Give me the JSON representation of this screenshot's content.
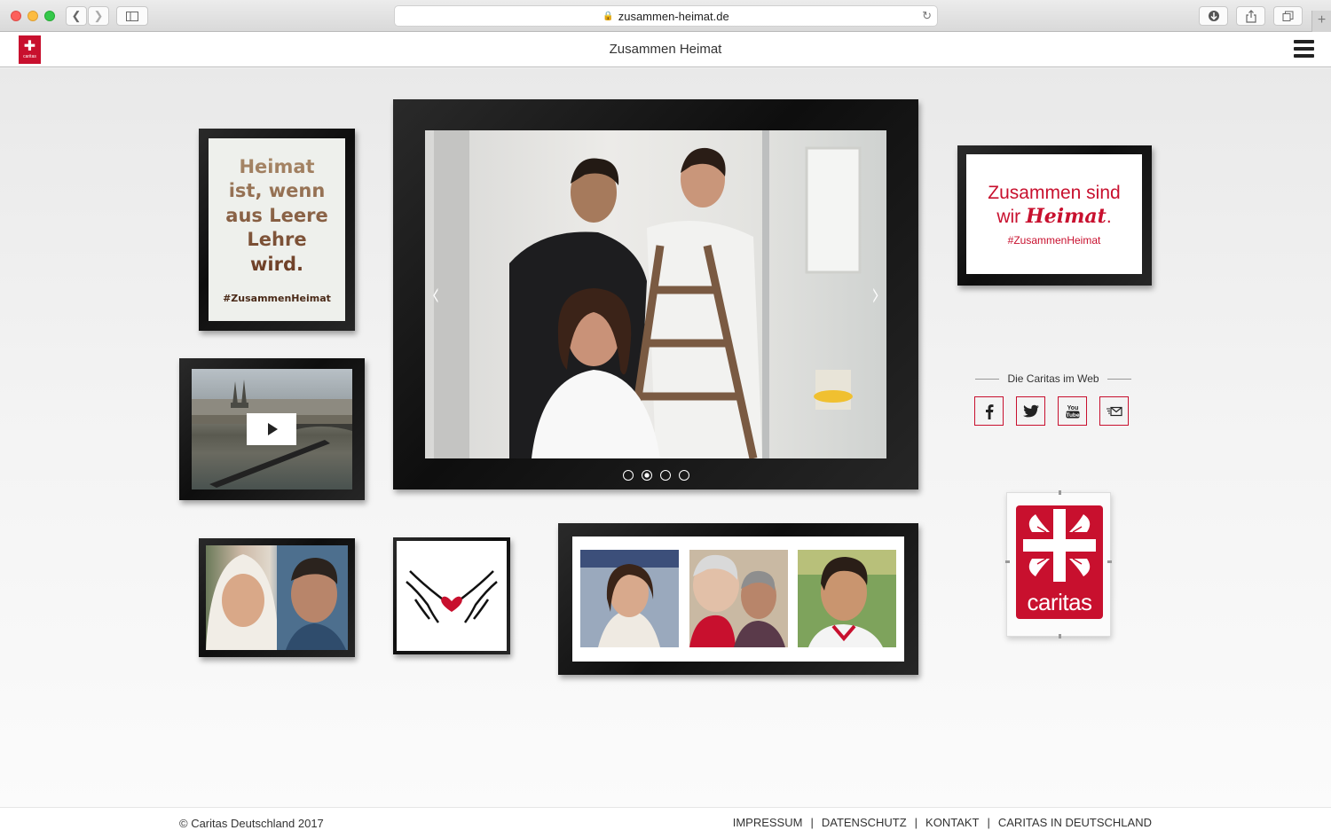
{
  "browser": {
    "url": "zusammen-heimat.de"
  },
  "header": {
    "title": "Zusammen Heimat",
    "logo_text": "caritas"
  },
  "quote_frame": {
    "lines": [
      "Heimat",
      "ist, wenn",
      "aus Leere",
      "Lehre",
      "wird."
    ],
    "hashtag": "#ZusammenHeimat"
  },
  "slogan_frame": {
    "line1": "Zusammen sind",
    "line2_prefix": "wir ",
    "line2_script": "Heimat",
    "line2_suffix": ".",
    "hashtag": "#ZusammenHeimat"
  },
  "slider": {
    "prev_label": "‹",
    "next_label": "›",
    "slide_count": 4,
    "active_index": 1
  },
  "social": {
    "heading": "Die Caritas im Web",
    "items": [
      {
        "name": "facebook-icon"
      },
      {
        "name": "twitter-icon"
      },
      {
        "name": "youtube-icon"
      },
      {
        "name": "mail-icon"
      }
    ]
  },
  "caritas_logo": {
    "word": "caritas"
  },
  "footer": {
    "copyright": "© Caritas Deutschland 2017",
    "links": [
      "IMPRESSUM",
      "DATENSCHUTZ",
      "KONTAKT",
      "CARITAS IN DEUTSCHLAND"
    ]
  },
  "colors": {
    "brand_red": "#c8102e",
    "frame_black": "#111111"
  }
}
